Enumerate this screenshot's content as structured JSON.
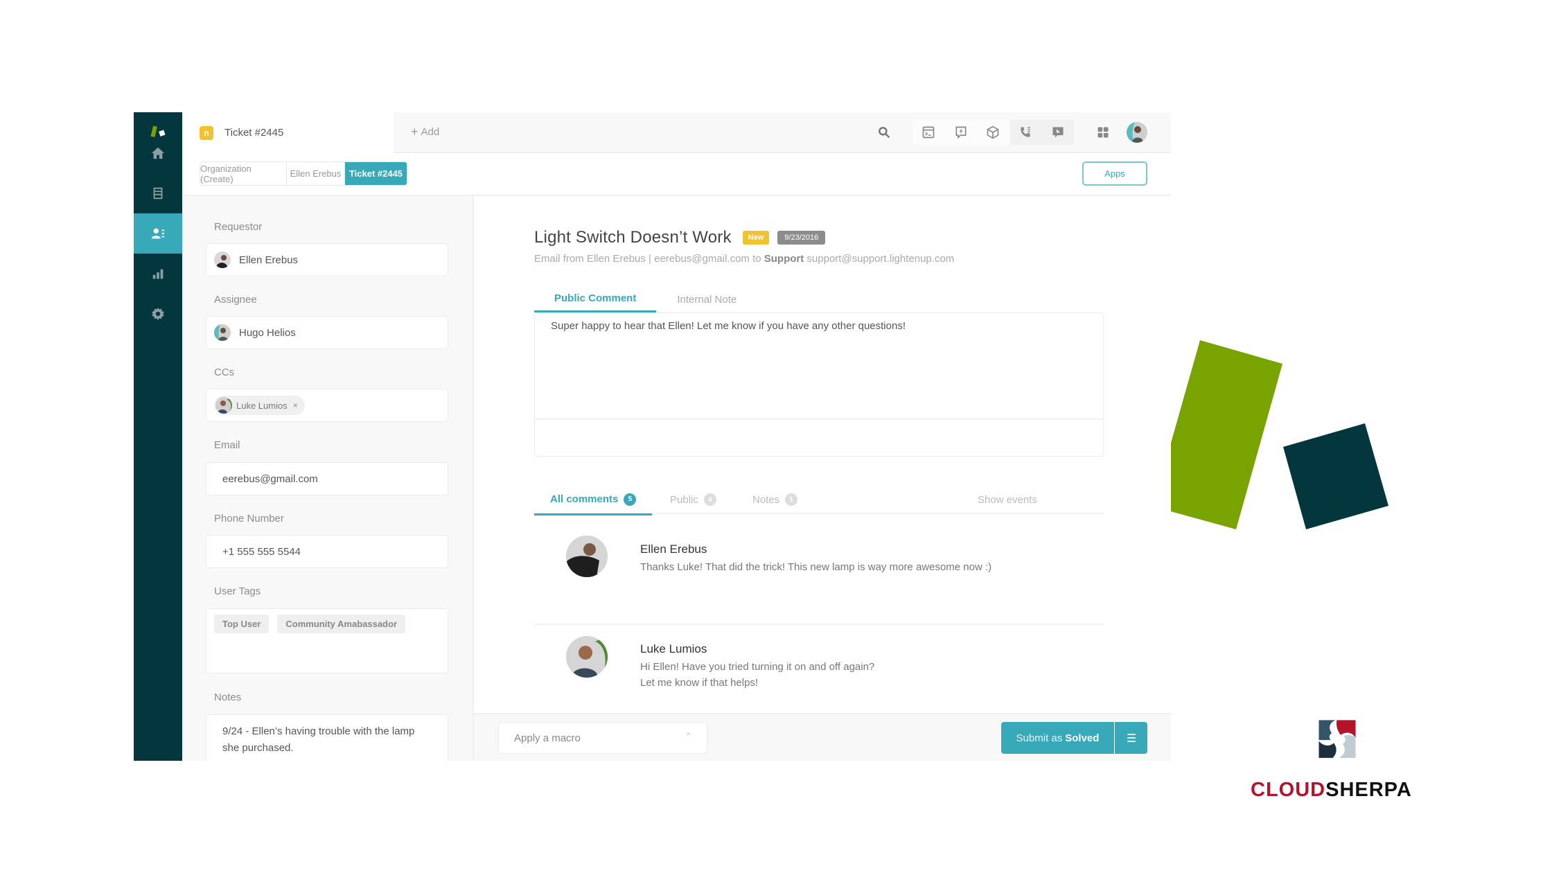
{
  "colors": {
    "sidebar_bg": "#03363d",
    "accent": "#37a9b9",
    "badge_new": "#f1c232",
    "deco_green": "#78a300",
    "deco_dark": "#03363d",
    "brand_red": "#b5122b"
  },
  "sidebar": {
    "items": [
      {
        "name": "logo",
        "icon": "zendesk-logo-icon"
      },
      {
        "name": "home",
        "icon": "home-icon"
      },
      {
        "name": "views",
        "icon": "views-icon"
      },
      {
        "name": "customers",
        "icon": "customers-icon",
        "active": true
      },
      {
        "name": "reporting",
        "icon": "bar-chart-icon"
      },
      {
        "name": "admin",
        "icon": "gear-icon"
      }
    ]
  },
  "header": {
    "ticket_badge": "n",
    "ticket_label": "Ticket #2445",
    "add_label": "Add",
    "icons": [
      "search-icon",
      "console-icon",
      "talk-icon",
      "product-box-icon",
      "phone-icon",
      "chat-icon",
      "apps-grid-icon",
      "user-avatar"
    ]
  },
  "nav_tabs": [
    {
      "label": "Organization (Create)",
      "active": false
    },
    {
      "label": "Ellen Erebus",
      "active": false
    },
    {
      "label": "Ticket #2445",
      "active": true
    }
  ],
  "apps_button": "Apps",
  "left_panel": {
    "requestor_label": "Requestor",
    "requestor": "Ellen Erebus",
    "assignee_label": "Assignee",
    "assignee": "Hugo Helios",
    "ccs_label": "CCs",
    "ccs": [
      "Luke Lumios"
    ],
    "cc_remove": "×",
    "email_label": "Email",
    "email": "eerebus@gmail.com",
    "phone_label": "Phone Number",
    "phone": "+1 555 555 5544",
    "tags_label": "User Tags",
    "tags": [
      "Top User",
      "Community Amabassador"
    ],
    "notes_label": "Notes",
    "notes": "9/24 - Ellen’s having trouble with the lamp she purchased."
  },
  "ticket": {
    "title": "Light Switch Doesn’t Work",
    "status": "New",
    "date": "9/23/2016",
    "meta_prefix": "Email from Ellen Erebus  |  eerebus@gmail.com to ",
    "meta_bold": "Support",
    "meta_suffix": " support@support.lightenup.com",
    "reply_tabs": [
      {
        "label": "Public Comment",
        "active": true
      },
      {
        "label": "Internal Note",
        "active": false
      }
    ],
    "reply_text": "Super happy to hear that Ellen! Let me know if you have any other questions!",
    "comment_filters": [
      {
        "label": "All comments",
        "count": "5",
        "active": true
      },
      {
        "label": "Public",
        "count": "4",
        "active": false
      },
      {
        "label": "Notes",
        "count": "1",
        "active": false
      }
    ],
    "show_events": "Show events",
    "comments": [
      {
        "author": "Ellen Erebus",
        "lines": [
          "Thanks Luke! That did the trick! This new lamp is way more awesome now :)"
        ]
      },
      {
        "author": "Luke Lumios",
        "lines": [
          "Hi Ellen! Have you tried turning it on and off again?",
          "Let me know if that helps!"
        ]
      }
    ]
  },
  "bottom_bar": {
    "macro_placeholder": "Apply a macro",
    "submit_prefix": "Submit as ",
    "submit_status": "Solved"
  },
  "branding": {
    "word_red": "CLOUD",
    "word_black": "SHERPA"
  }
}
